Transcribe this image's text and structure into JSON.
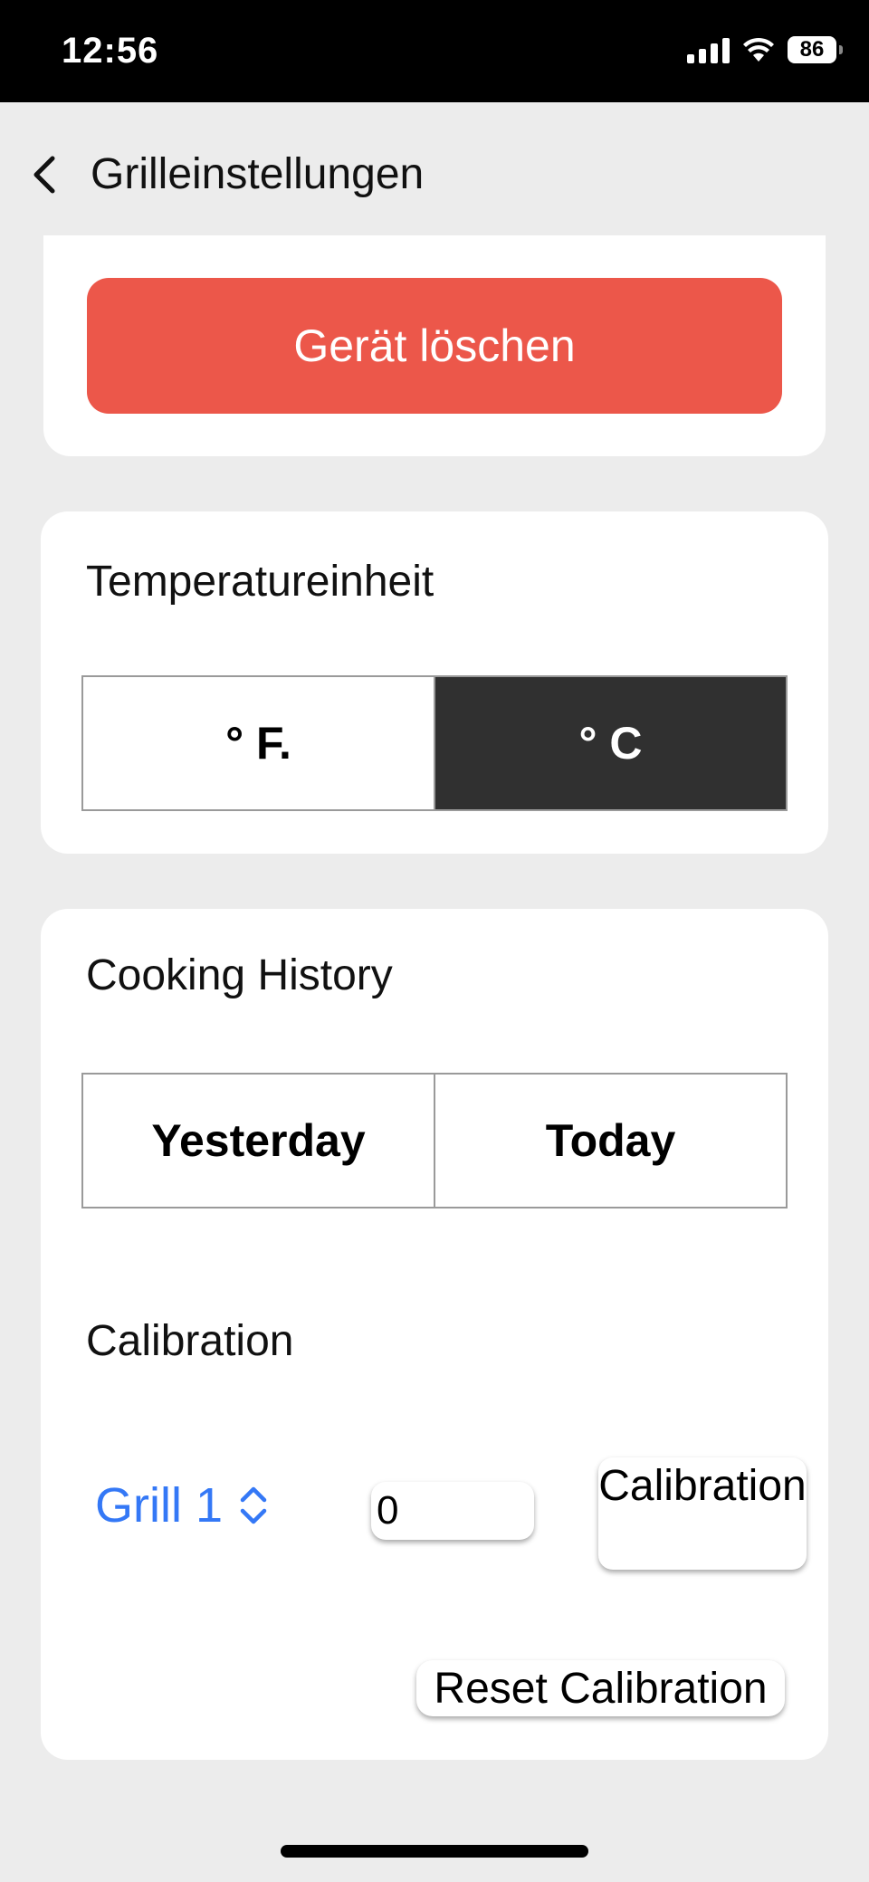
{
  "status_bar": {
    "time": "12:56",
    "battery": "86"
  },
  "nav": {
    "title": "Grilleinstellungen"
  },
  "device": {
    "delete_label": "Gerät löschen"
  },
  "temperature": {
    "title": "Temperatureinheit",
    "options": [
      "° F.",
      "° C"
    ],
    "selected": "° C"
  },
  "history": {
    "title": "Cooking History",
    "options": [
      "Yesterday",
      "Today"
    ]
  },
  "calibration": {
    "title": "Calibration",
    "grill_select_value": "Grill 1",
    "input_value": "0",
    "button_label": "Calibration",
    "reset_label": "Reset Calibration"
  },
  "colors": {
    "accent": "#3478f6",
    "danger": "#ec574a",
    "selected_segment": "#303030"
  }
}
